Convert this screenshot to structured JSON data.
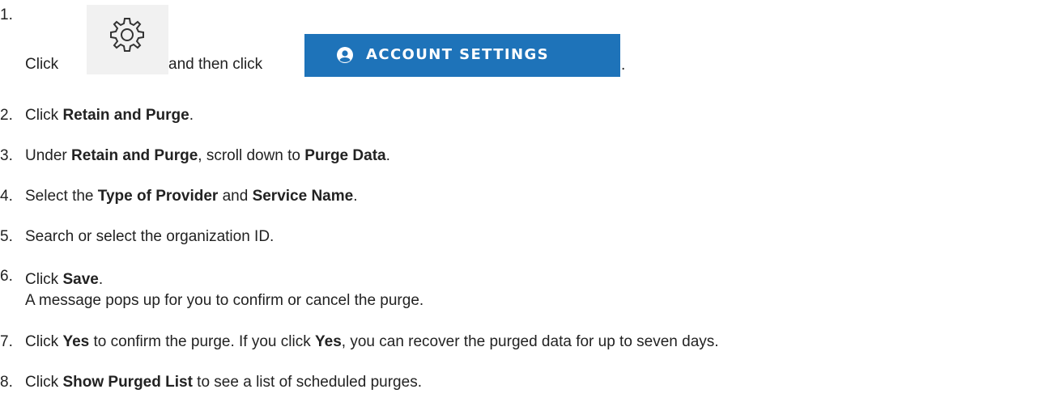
{
  "steps": [
    {
      "num": "1.",
      "parts": [
        "Click ",
        " and then click ",
        "."
      ]
    },
    {
      "num": "2.",
      "a": "Click ",
      "b1": "Retain and Purge",
      "c": "."
    },
    {
      "num": "3.",
      "a": "Under ",
      "b1": "Retain and Purge",
      "c": ", scroll down to ",
      "b2": "Purge Data",
      "d": "."
    },
    {
      "num": "4.",
      "a": "Select the ",
      "b1": "Type of Provider",
      "c": " and ",
      "b2": "Service Name",
      "d": "."
    },
    {
      "num": "5.",
      "a": "Search or select the organization ID."
    },
    {
      "num": "6.",
      "a": "Click ",
      "b1": "Save",
      "c": ".",
      "line2": "A message pops up for you to confirm or cancel the purge."
    },
    {
      "num": "7.",
      "a": "Click ",
      "b1": "Yes",
      "c": " to confirm the purge. If you click ",
      "b2": "Yes",
      "d": ", you can recover the purged data for up to seven days."
    },
    {
      "num": "8.",
      "a": "Click ",
      "b1": "Show Purged List",
      "c": " to see a list of scheduled purges."
    }
  ],
  "account_settings_button": {
    "label": "ACCOUNT SETTINGS",
    "bg_color": "#1e73b9",
    "icon": "person-circle-icon"
  },
  "settings_icon": {
    "icon": "gear-icon",
    "bg_color": "#f1f1f1"
  }
}
